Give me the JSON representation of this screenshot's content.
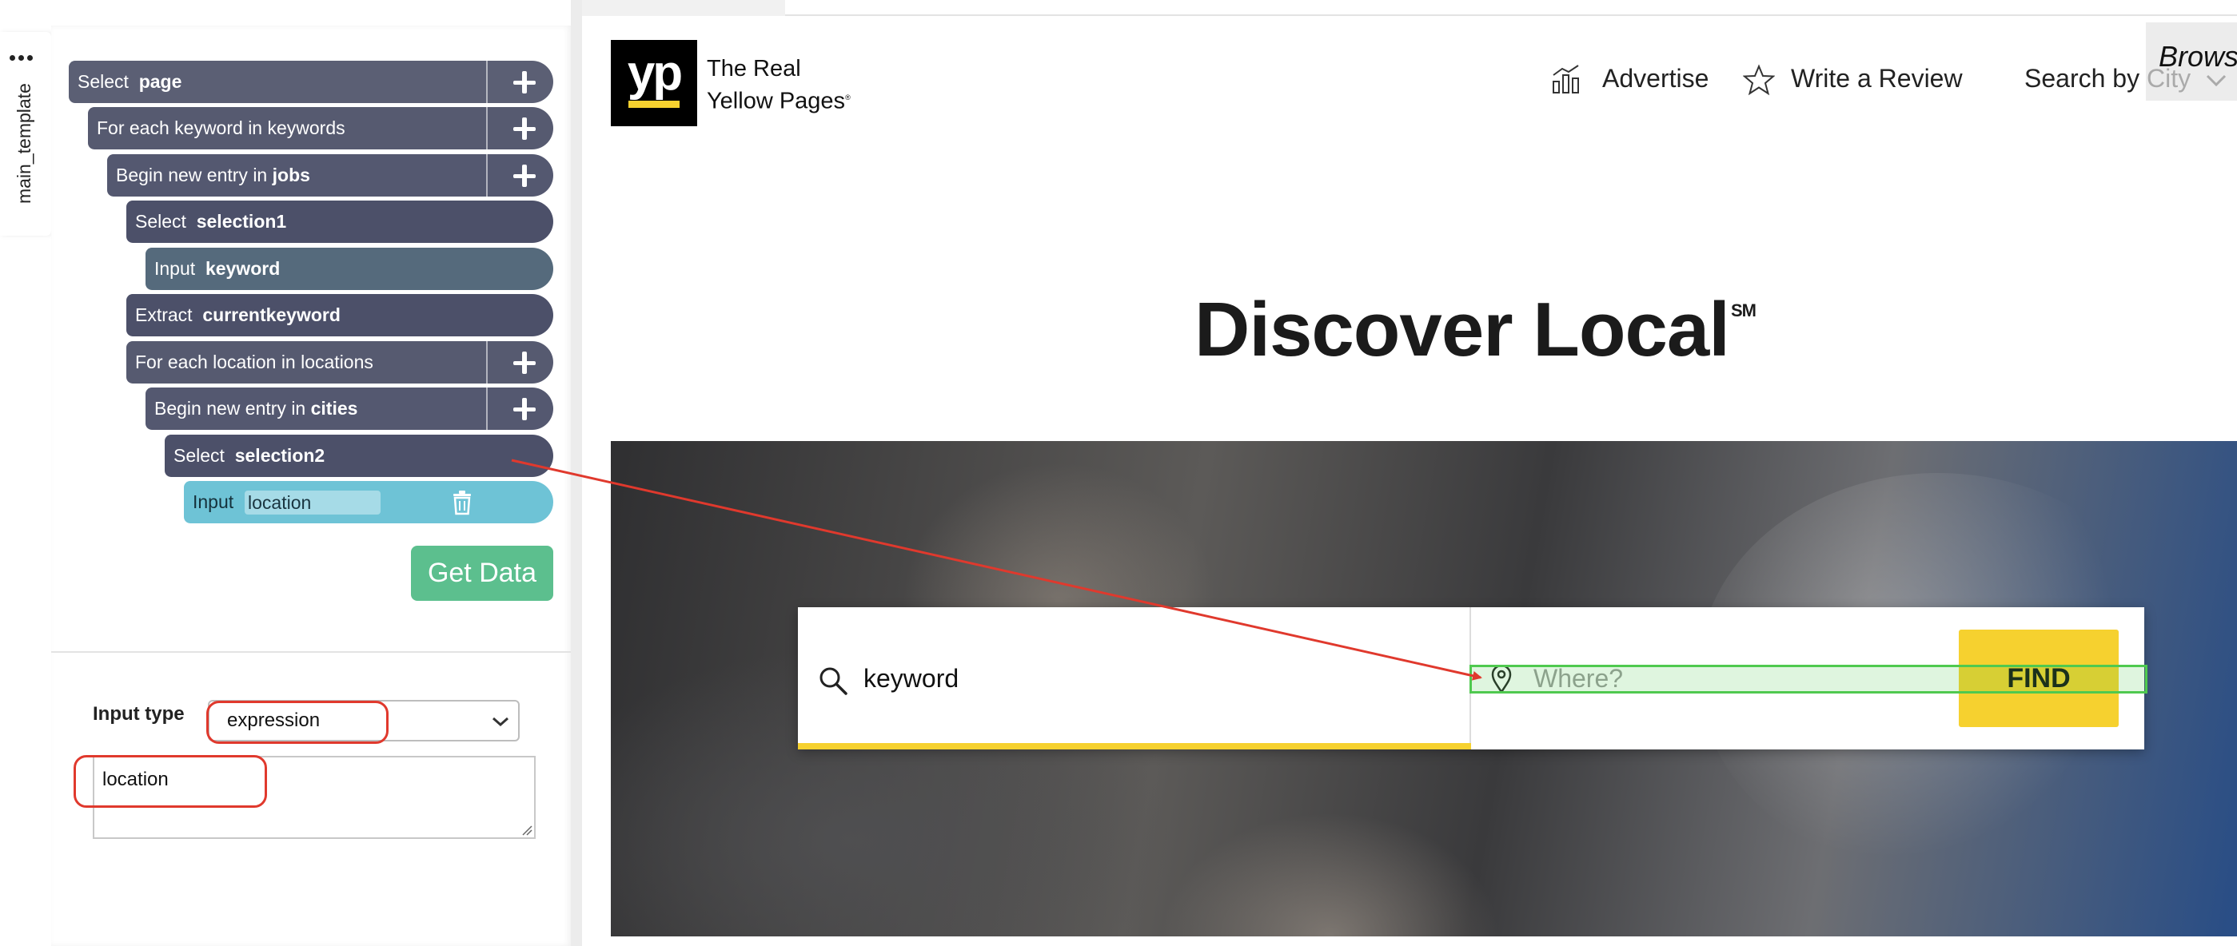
{
  "side_tab": {
    "label": "main_template"
  },
  "commands": [
    {
      "verb": "Select",
      "target": "page"
    },
    {
      "verb": "For each keyword in keywords",
      "target": ""
    },
    {
      "verb": "Begin new entry in",
      "target": "jobs"
    },
    {
      "verb": "Select",
      "target": "selection1"
    },
    {
      "verb": "Input",
      "target": "keyword"
    },
    {
      "verb": "Extract",
      "target": "currentkeyword"
    },
    {
      "verb": "For each location in locations",
      "target": ""
    },
    {
      "verb": "Begin new entry in",
      "target": "cities"
    },
    {
      "verb": "Select",
      "target": "selection2"
    },
    {
      "verb": "Input",
      "target": "location"
    }
  ],
  "get_data_label": "Get Data",
  "input_type": {
    "label": "Input type",
    "selected": "expression",
    "expression_value": "location"
  },
  "site": {
    "logo_text": "yp",
    "name_line1": "The Real",
    "name_line2": "Yellow Pages",
    "name_mark": "®",
    "nav": {
      "advertise": "Advertise",
      "write_review": "Write a Review",
      "search_by": "Search by",
      "city": "City",
      "browse": "Brows"
    },
    "hero_title": "Discover Local",
    "hero_mark": "SM",
    "search": {
      "what_value": "keyword",
      "where_placeholder": "Where?",
      "find_label": "FIND"
    }
  },
  "colors": {
    "accent_yellow": "#f6d12f",
    "panel_block": "#545870",
    "active_block": "#6ec3d6",
    "get_data": "#5cbf8e",
    "annotation_red": "#e0392d",
    "highlight_green": "#4fc94f"
  }
}
